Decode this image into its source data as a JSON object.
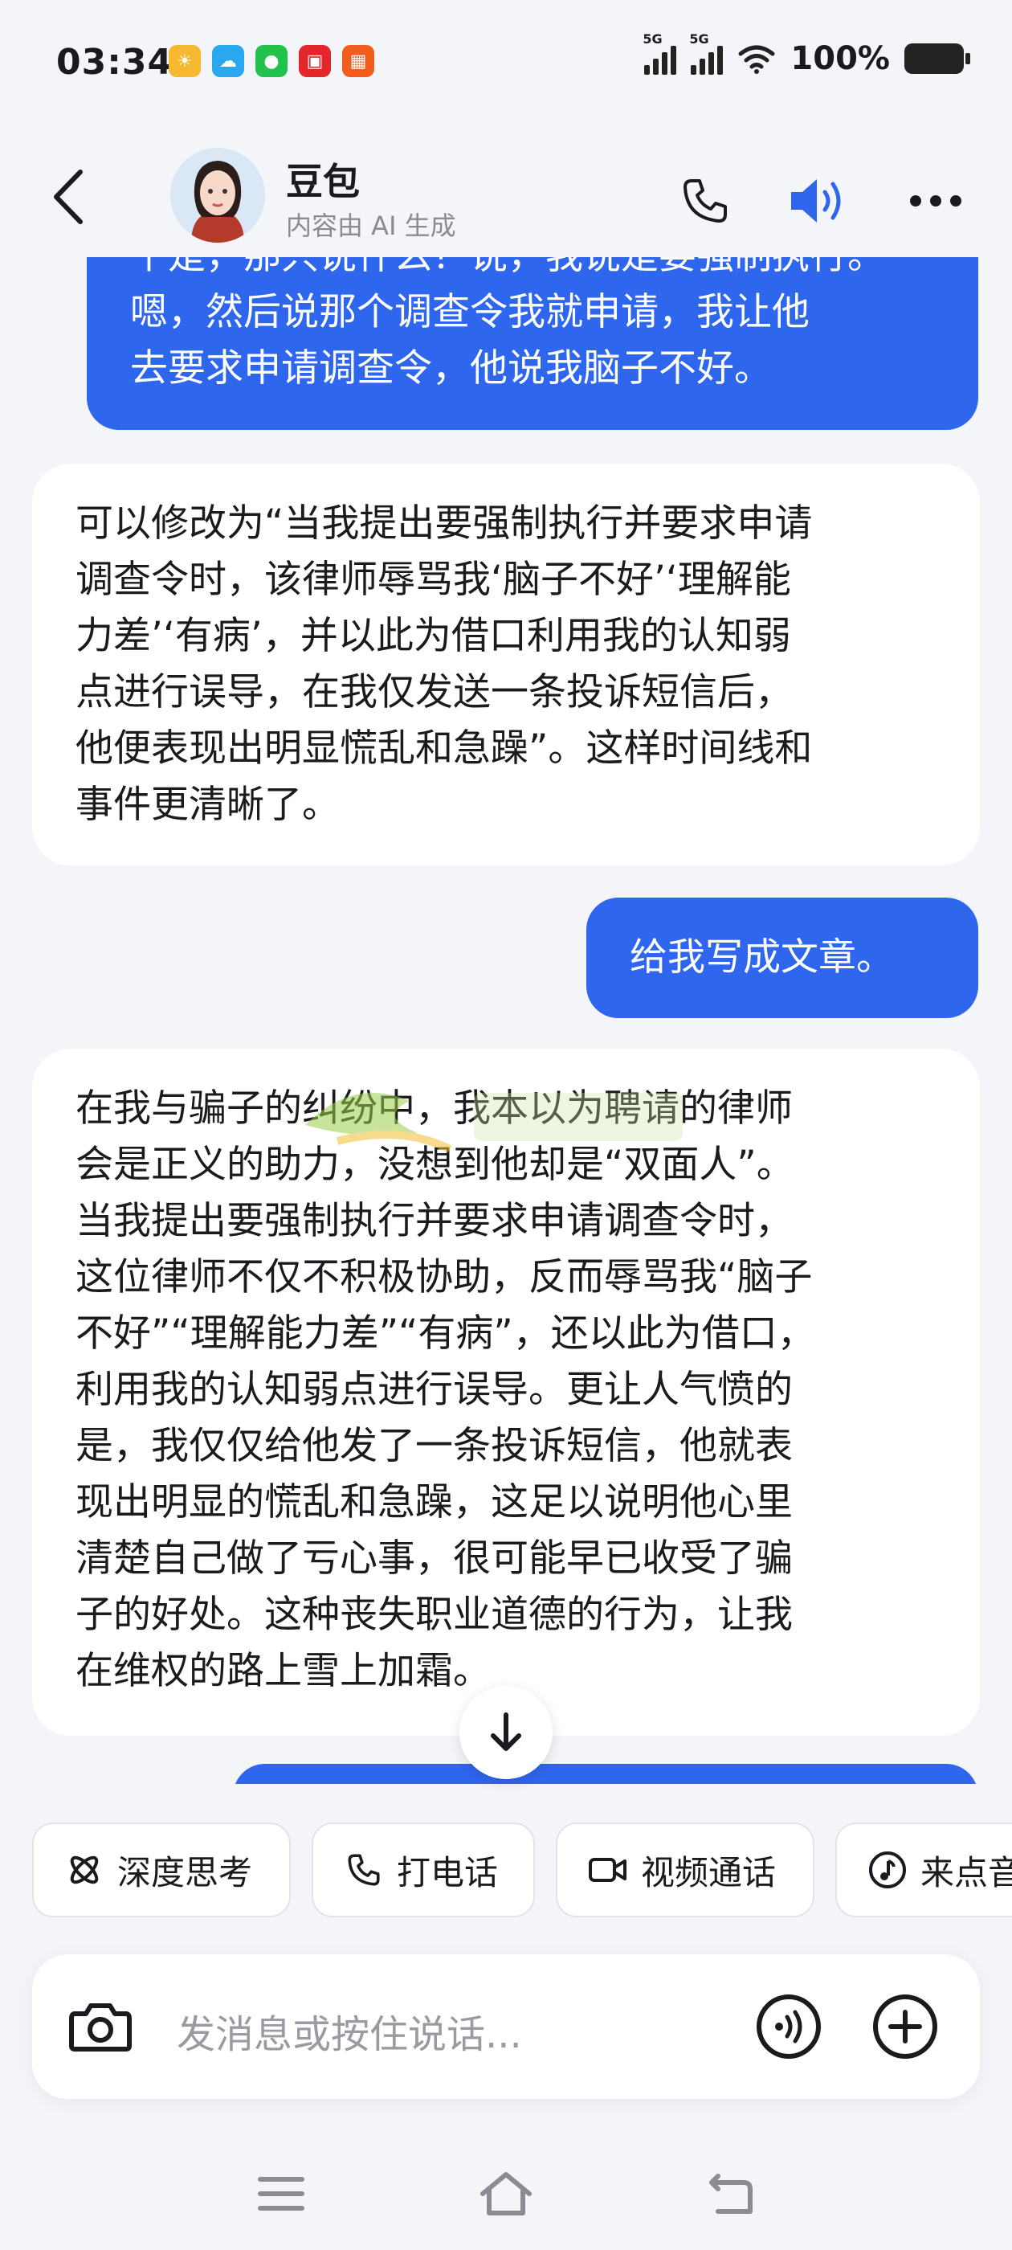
{
  "status_bar": {
    "time": "03:34",
    "network_1": "5G",
    "network_2": "5G",
    "battery": "100%"
  },
  "header": {
    "name": "豆包",
    "subtitle": "内容由 AI 生成"
  },
  "messages": [
    {
      "role": "user",
      "lines": [
        "个是，那只说什么？说，我说是要强制执行。",
        "嗯，然后说那个调查令我就申请，我让他",
        "去要求申请调查令，他说我脑子不好。"
      ]
    },
    {
      "role": "ai",
      "lines": [
        "可以修改为“当我提出要强制执行并要求申请",
        "调查令时，该律师辱骂我‘脑子不好’‘理解能",
        "力差’‘有病’，并以此为借口利用我的认知弱",
        "点进行误导，在我仅发送一条投诉短信后，",
        "他便表现出明显慌乱和急躁”。这样时间线和",
        "事件更清晰了。"
      ]
    },
    {
      "role": "user",
      "lines": [
        "给我写成文章。"
      ]
    },
    {
      "role": "ai",
      "lines": [
        "在我与骗子的纠纷中，我本以为聘请的律师",
        "会是正义的助力，没想到他却是“双面人”。",
        "当我提出要强制执行并要求申请调查令时，",
        "这位律师不仅不积极协助，反而辱骂我“脑子",
        "不好”“理解能力差”“有病”，还以此为借口，",
        "利用我的认知弱点进行误导。更让人气愤的",
        "是，我仅仅给他发了一条投诉短信，他就表",
        "现出明显的慌乱和急躁，这足以说明他心里",
        "清楚自己做了亏心事，很可能早已收受了骗",
        "子的好处。这种丧失职业道德的行为，让我",
        "在维权的路上雪上加霜。"
      ]
    }
  ],
  "quick_actions": [
    "深度思考",
    "打电话",
    "视频通话",
    "来点音乐"
  ],
  "input": {
    "placeholder": "发消息或按住说话..."
  },
  "icons": {
    "back": "chevron-left-icon",
    "phone": "phone-icon",
    "speaker": "speaker-icon",
    "more": "more-icon",
    "camera": "camera-icon",
    "voice": "voice-wave-icon",
    "plus": "plus-icon"
  },
  "colors": {
    "accent": "#2f66ee",
    "background": "#f4f5f8",
    "ai_bubble": "#ffffff"
  }
}
